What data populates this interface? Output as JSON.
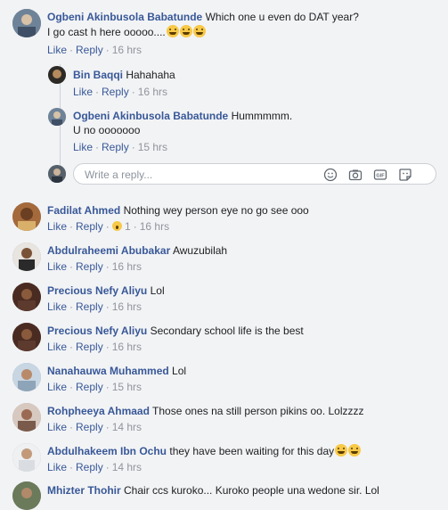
{
  "labels": {
    "like": "Like",
    "reply": "Reply",
    "sep": "·"
  },
  "thread": {
    "comment": {
      "author": "Ogbeni Akinbusola Babatunde",
      "text_line1": "Which one u even do DAT year?",
      "text_line2": "I go cast h here ooooo....",
      "time": "16 hrs"
    },
    "replies": [
      {
        "author": "Bin Baqqi",
        "text": "Hahahaha",
        "time": "16 hrs"
      },
      {
        "author": "Ogbeni Akinbusola Babatunde",
        "text_line1": "Hummmmm.",
        "text_line2": "U no ooooooo",
        "time": "15 hrs"
      }
    ],
    "reply_box": {
      "placeholder": "Write a reply..."
    }
  },
  "comments": [
    {
      "author": "Fadilat Ahmed",
      "text": "Nothing wey person eye no go see ooo",
      "reaction_count": "1",
      "time": "16 hrs"
    },
    {
      "author": "Abdulraheemi Abubakar",
      "text": "Awuzubilah",
      "time": "16 hrs"
    },
    {
      "author": "Precious Nefy Aliyu",
      "text": "Lol",
      "time": "16 hrs"
    },
    {
      "author": "Precious Nefy Aliyu",
      "text": "Secondary school life is the best",
      "time": "16 hrs"
    },
    {
      "author": "Nanahauwa Muhammed",
      "text": "Lol",
      "time": "15 hrs"
    },
    {
      "author": "Rohpheeya Ahmaad",
      "text": "Those ones na still person pikins oo. Lolzzzz",
      "time": "14 hrs"
    },
    {
      "author": "Abdulhakeem Ibn Ochu",
      "text": "they have been waiting for this day",
      "time": "14 hrs"
    },
    {
      "author": "Mhizter Thohir",
      "text": "Chair ccs kuroko... Kuroko people una wedone sir. Lol"
    }
  ],
  "icons": [
    "grin-emoji-icon",
    "surprised-reaction-icon",
    "smiley-icon",
    "camera-icon",
    "gif-icon",
    "sticker-icon"
  ]
}
